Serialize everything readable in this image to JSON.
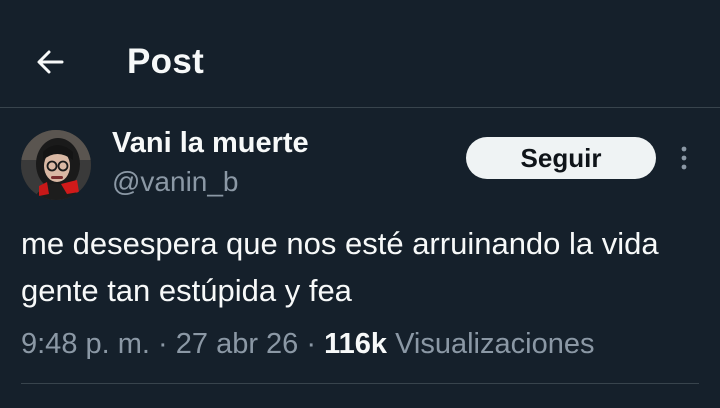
{
  "header": {
    "title": "Post",
    "back_icon": "arrow-left-icon"
  },
  "tweet": {
    "author": {
      "name": "Vani la muerte",
      "handle": "@vanin_b",
      "avatar_icon": "avatar-photo"
    },
    "follow_label": "Seguir",
    "more_icon": "more-vertical-icon",
    "text": "me desespera que nos esté arruinando la vida gente tan estúpida y fea",
    "time": "9:48 p. m.",
    "date": "27 abr 26",
    "separator": "·",
    "views_count": "116k",
    "views_label": "Visualizaciones"
  },
  "colors": {
    "background": "#15202b",
    "primary_text": "#f7f9f9",
    "secondary_text": "#8b98a5",
    "border": "#38444d",
    "button_bg": "#eff3f4",
    "button_text": "#0f1419"
  }
}
